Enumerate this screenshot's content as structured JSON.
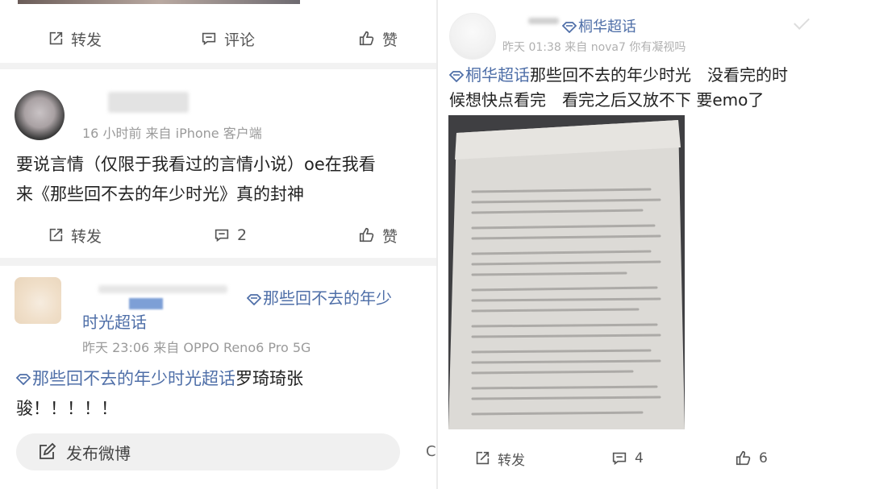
{
  "left": {
    "post0": {
      "actions": {
        "repost": "转发",
        "comment": "评论",
        "like": "赞"
      }
    },
    "post1": {
      "meta": "16 小时前  来自 iPhone 客户端",
      "text_lines": [
        "要说言情（仅限于我看过的言情小说）oe在我看",
        "来《那些回不去的年少时光》真的封神"
      ],
      "actions": {
        "repost": "转发",
        "comment": "2",
        "like": "赞"
      }
    },
    "post2": {
      "topic_header_1": "那些回不去的年少",
      "topic_header_2": "时光超话",
      "meta": "昨天 23:06  来自 OPPO Reno6 Pro 5G",
      "topic_inline": "那些回不去的年少时光超话",
      "text_after_topic": "罗琦琦张",
      "text_line2": "骏！！！！！"
    },
    "compose": {
      "label": "发布微博"
    },
    "edge_char": "C"
  },
  "right": {
    "header": {
      "topic": "桐华超话",
      "meta": "昨天 01:38  来自 nova7 你有凝视吗"
    },
    "topic_inline": "桐华超话",
    "text_line1_rest": "那些回不去的年少时光　没看完的时",
    "text_line2": "候想快点看完　看完之后又放不下 要emo了",
    "actions": {
      "repost": "转发",
      "comment": "4",
      "like": "6"
    }
  },
  "colors": {
    "topic": "#4f6fa8",
    "meta": "#9a9a9a",
    "divider": "#ebebeb"
  }
}
